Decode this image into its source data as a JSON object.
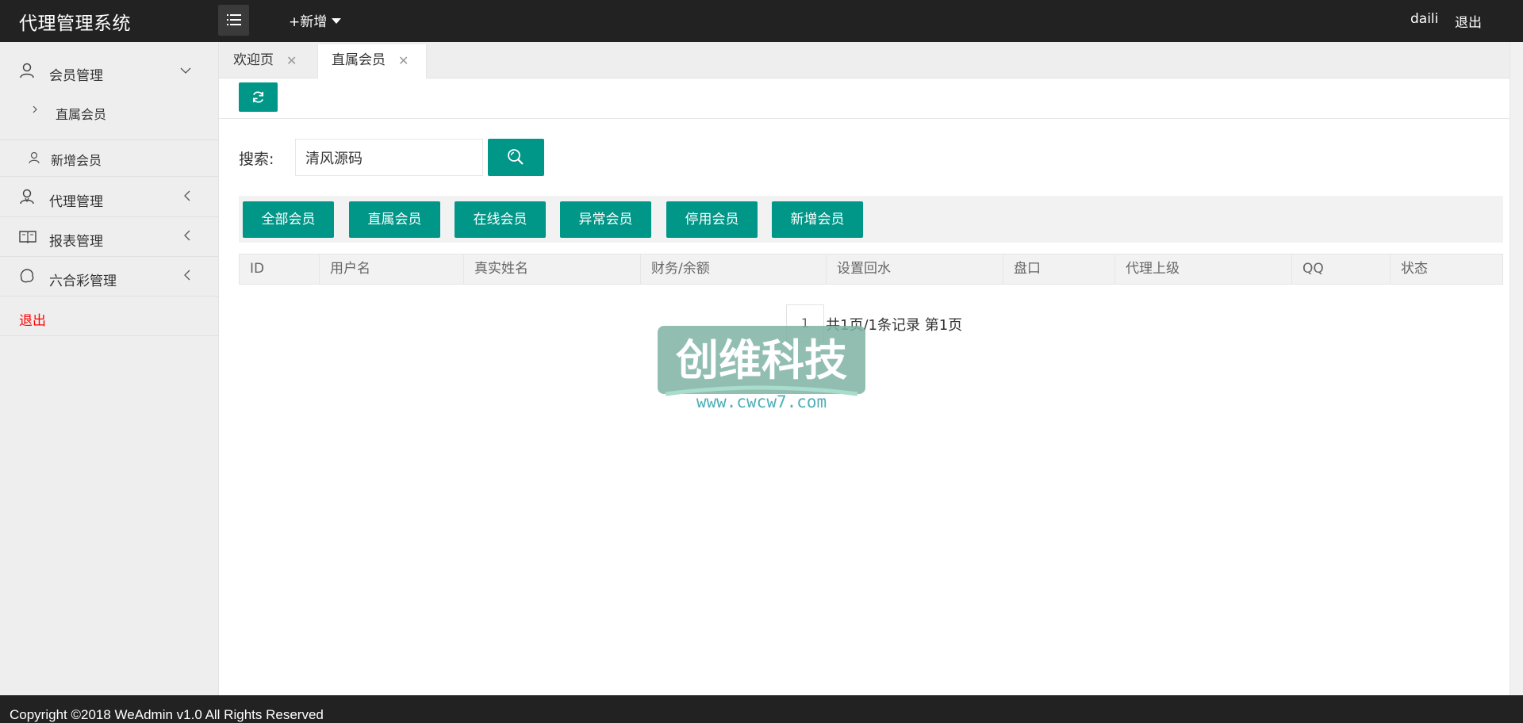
{
  "header": {
    "logo": "代理管理系统",
    "add_new": "+新增",
    "username": "daili",
    "logout": "退出"
  },
  "sidebar": {
    "groups": [
      {
        "label": "会员管理",
        "icon": "user-icon",
        "expanded": true
      },
      {
        "label": "代理管理",
        "icon": "agent-icon",
        "expanded": false
      },
      {
        "label": "报表管理",
        "icon": "book-icon",
        "expanded": false
      },
      {
        "label": "六合彩管理",
        "icon": "lottery-icon",
        "expanded": false
      }
    ],
    "sub_items": [
      {
        "label": "直属会员",
        "icon": "chevron-right-icon"
      },
      {
        "label": "新增会员",
        "icon": "user-icon"
      }
    ],
    "logout": "退出"
  },
  "tabs": [
    {
      "label": "欢迎页",
      "active": false
    },
    {
      "label": "直属会员",
      "active": true
    }
  ],
  "search": {
    "label": "搜索:",
    "value": "清风源码"
  },
  "filters": [
    "全部会员",
    "直属会员",
    "在线会员",
    "异常会员",
    "停用会员",
    "新增会员"
  ],
  "table": {
    "headers": [
      "ID",
      "用户名",
      "真实姓名",
      "财务/余额",
      "设置回水",
      "盘口",
      "代理上级",
      "QQ",
      "状态"
    ]
  },
  "pagination": {
    "current": "1",
    "info": "共1页/1条记录 第1页"
  },
  "watermark": {
    "text": "创维科技",
    "url": "www.cwcw7.com"
  },
  "footer": {
    "copyright": "Copyright ©2018 WeAdmin v1.0 All Rights Reserved"
  },
  "colors": {
    "accent": "#009688",
    "header_bg": "#222222",
    "danger": "#ff0000"
  }
}
